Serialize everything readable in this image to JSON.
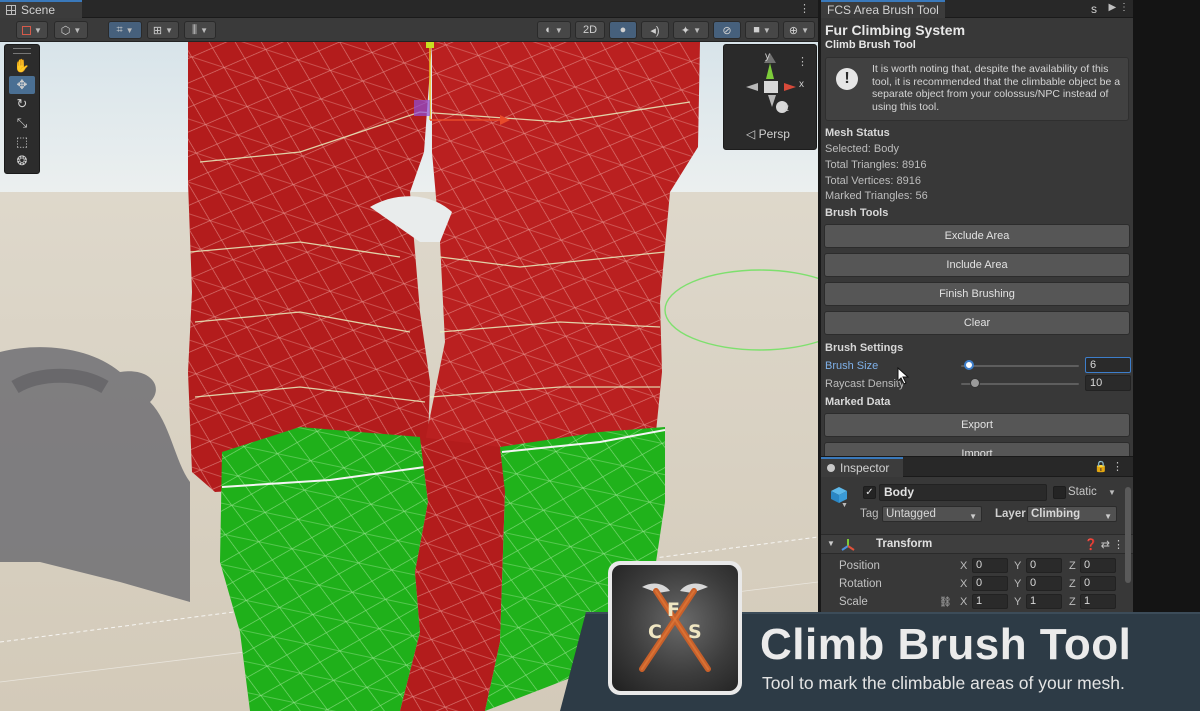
{
  "scene": {
    "tab_label": "Scene",
    "toolbar": {
      "mode_2d_label": "2D"
    },
    "persp_label": "◁ Persp",
    "gizmo_axes": {
      "y": "y",
      "x": "x",
      "z": "z"
    }
  },
  "brush_panel": {
    "tab_label": "FCS Area Brush Tool",
    "second_tab_label": "s",
    "title": "Fur Climbing System",
    "subtitle": "Climb Brush Tool",
    "help_text": "It is worth noting that, despite the availability of this tool, it is recommended that the climbable object be a separate object from your colossus/NPC instead of using this tool.",
    "mesh_status": {
      "header": "Mesh Status",
      "selected": "Selected: Body",
      "total_triangles": "Total Triangles: 8916",
      "total_vertices": "Total Vertices: 8916",
      "marked_triangles": "Marked Triangles: 56"
    },
    "brush_tools": {
      "header": "Brush Tools",
      "exclude_label": "Exclude Area",
      "include_label": "Include Area",
      "finish_label": "Finish Brushing",
      "clear_label": "Clear"
    },
    "brush_settings": {
      "header": "Brush Settings",
      "brush_size_label": "Brush Size",
      "brush_size_value": "6",
      "brush_size_fraction": 0.08,
      "raycast_density_label": "Raycast Density",
      "raycast_density_value": "10",
      "raycast_density_fraction": 0.12
    },
    "marked_data": {
      "header": "Marked Data",
      "export_label": "Export",
      "import_label": "Import"
    }
  },
  "inspector": {
    "tab_label": "Inspector",
    "object_name": "Body",
    "static_label": "Static",
    "tag_label": "Tag",
    "tag_value": "Untagged",
    "layer_label": "Layer",
    "layer_value": "Climbing",
    "transform": {
      "title": "Transform",
      "position": {
        "label": "Position",
        "x": "0",
        "y": "0",
        "z": "0"
      },
      "rotation": {
        "label": "Rotation",
        "x": "0",
        "y": "0",
        "z": "0"
      },
      "scale": {
        "label": "Scale",
        "x": "1",
        "y": "1",
        "z": "1"
      },
      "axis_x": "X",
      "axis_y": "Y",
      "axis_z": "Z"
    }
  },
  "banner": {
    "title": "Climb Brush Tool",
    "subtitle": "Tool to mark the climbable areas of your mesh.",
    "logo_letters": {
      "c1": "C",
      "f": "F",
      "c2": "C",
      "s": "S"
    }
  },
  "colors": {
    "mesh_red": "#c0201e",
    "mesh_green": "#22b41e",
    "selection_blue": "#3a79bb",
    "banner_bg": "#2d3b46"
  }
}
